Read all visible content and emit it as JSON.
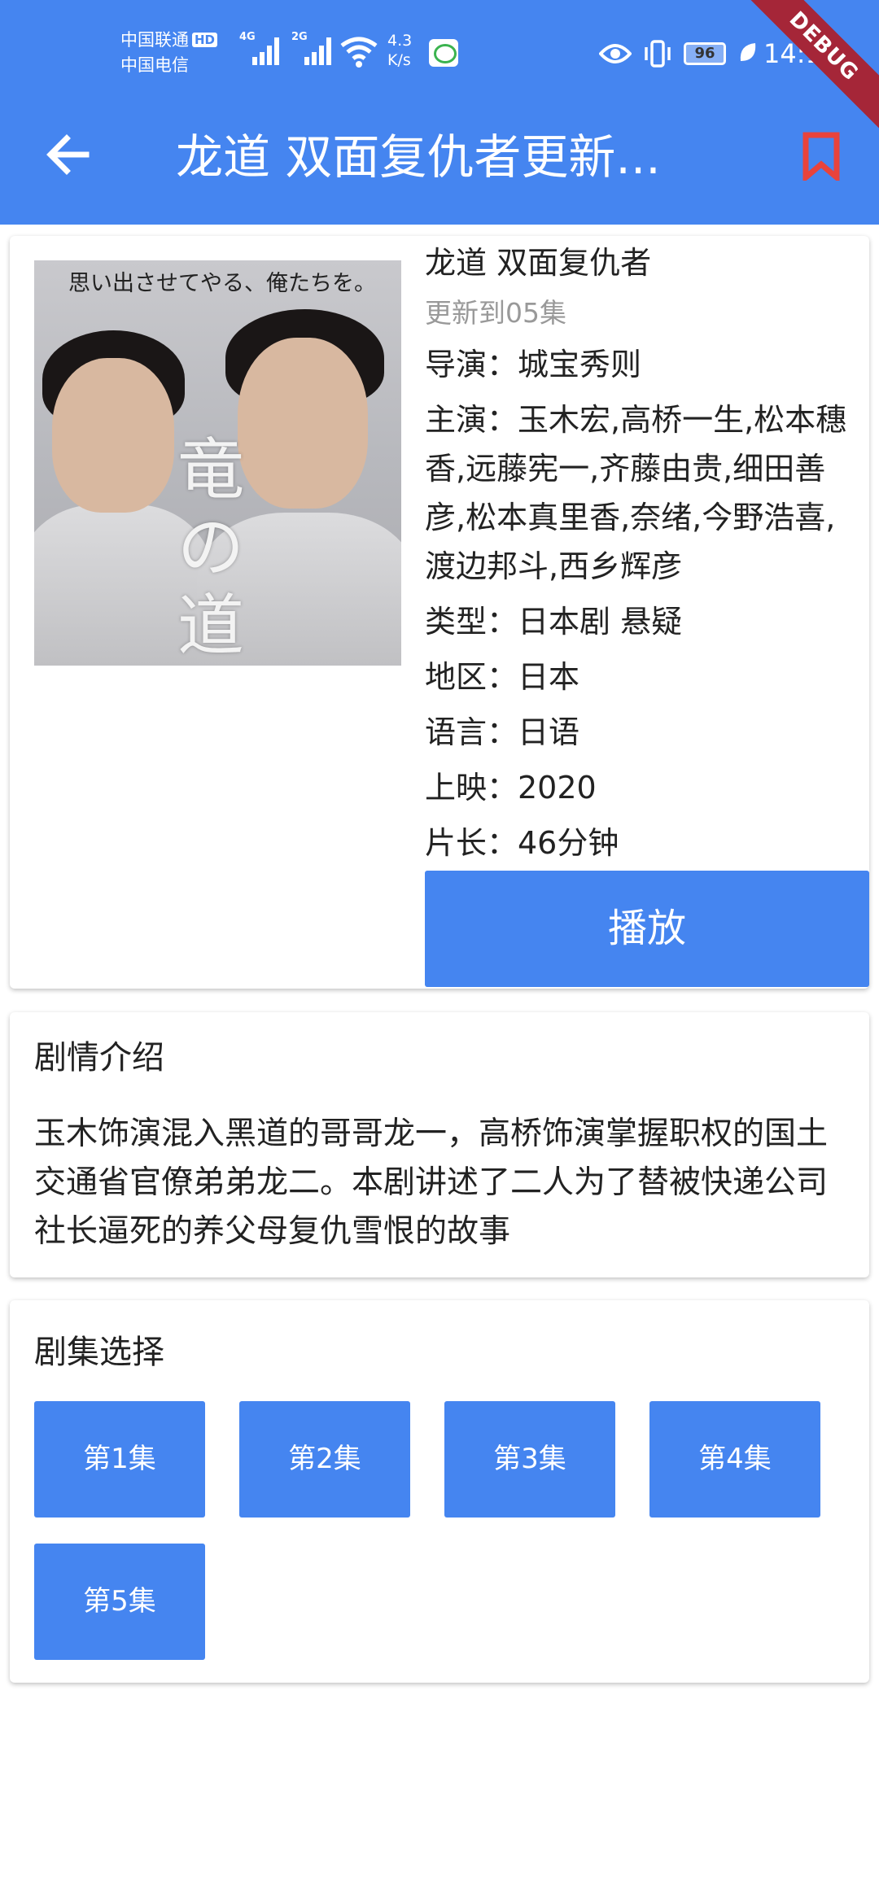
{
  "status_bar": {
    "carrier1": "中国联通",
    "hd_badge": "HD",
    "carrier2": "中国电信",
    "signal1_label": "4G",
    "signal2_label": "2G",
    "net_speed_value": "4.3",
    "net_speed_unit": "K/s",
    "battery": "96",
    "time": "14:19",
    "debug_banner": "DEBUG"
  },
  "app_bar": {
    "title": "龙道 双面复仇者更新...",
    "back_icon": "arrow-left-icon",
    "bookmark_icon": "bookmark-icon",
    "accent": "#4585f0",
    "bookmark_color": "#e8433c"
  },
  "details": {
    "poster_caption": "思い出させてやる、俺たちを。",
    "poster_title_jp": "竜の道",
    "name": "龙道 双面复仇者",
    "update": "更新到05集",
    "director": "导演：城宝秀则",
    "cast": "主演：玉木宏,高桥一生,松本穗香,远藤宪一,齐藤由贵,细田善彦,松本真里香,奈绪,今野浩喜,渡边邦斗,西乡辉彦",
    "genre": "类型：日本剧 悬疑",
    "region": "地区：日本",
    "language": "语言：日语",
    "release": "上映：2020",
    "duration": "片长：46分钟",
    "play_label": "播放"
  },
  "synopsis": {
    "title": "剧情介绍",
    "text": "玉木饰演混入黑道的哥哥龙一，高桥饰演掌握职权的国土交通省官僚弟弟龙二。本剧讲述了二人为了替被快递公司社长逼死的养父母复仇雪恨的故事"
  },
  "episodes": {
    "title": "剧集选择",
    "items": [
      "第1集",
      "第2集",
      "第3集",
      "第4集",
      "第5集"
    ]
  }
}
